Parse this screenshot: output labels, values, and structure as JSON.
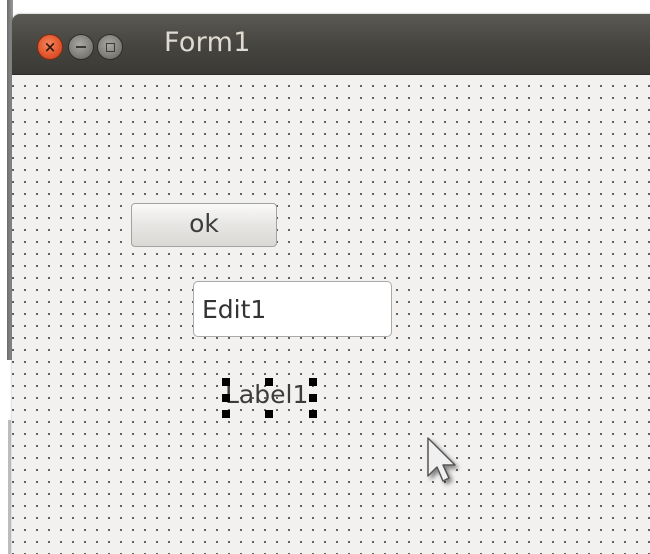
{
  "window": {
    "title": "Form1",
    "controls": {
      "close_icon": "close-icon",
      "minimize_icon": "minimize-icon",
      "maximize_icon": "maximize-icon"
    }
  },
  "form": {
    "button": {
      "label": "ok"
    },
    "edit": {
      "value": "Edit1"
    },
    "label": {
      "text": "Label1",
      "selected": true
    }
  },
  "colors": {
    "titlebar": "#45443f",
    "close_button": "#e4572e",
    "canvas": "#f2f1f0",
    "grid_dot": "#4a4a4a",
    "selection_handle": "#000000"
  }
}
